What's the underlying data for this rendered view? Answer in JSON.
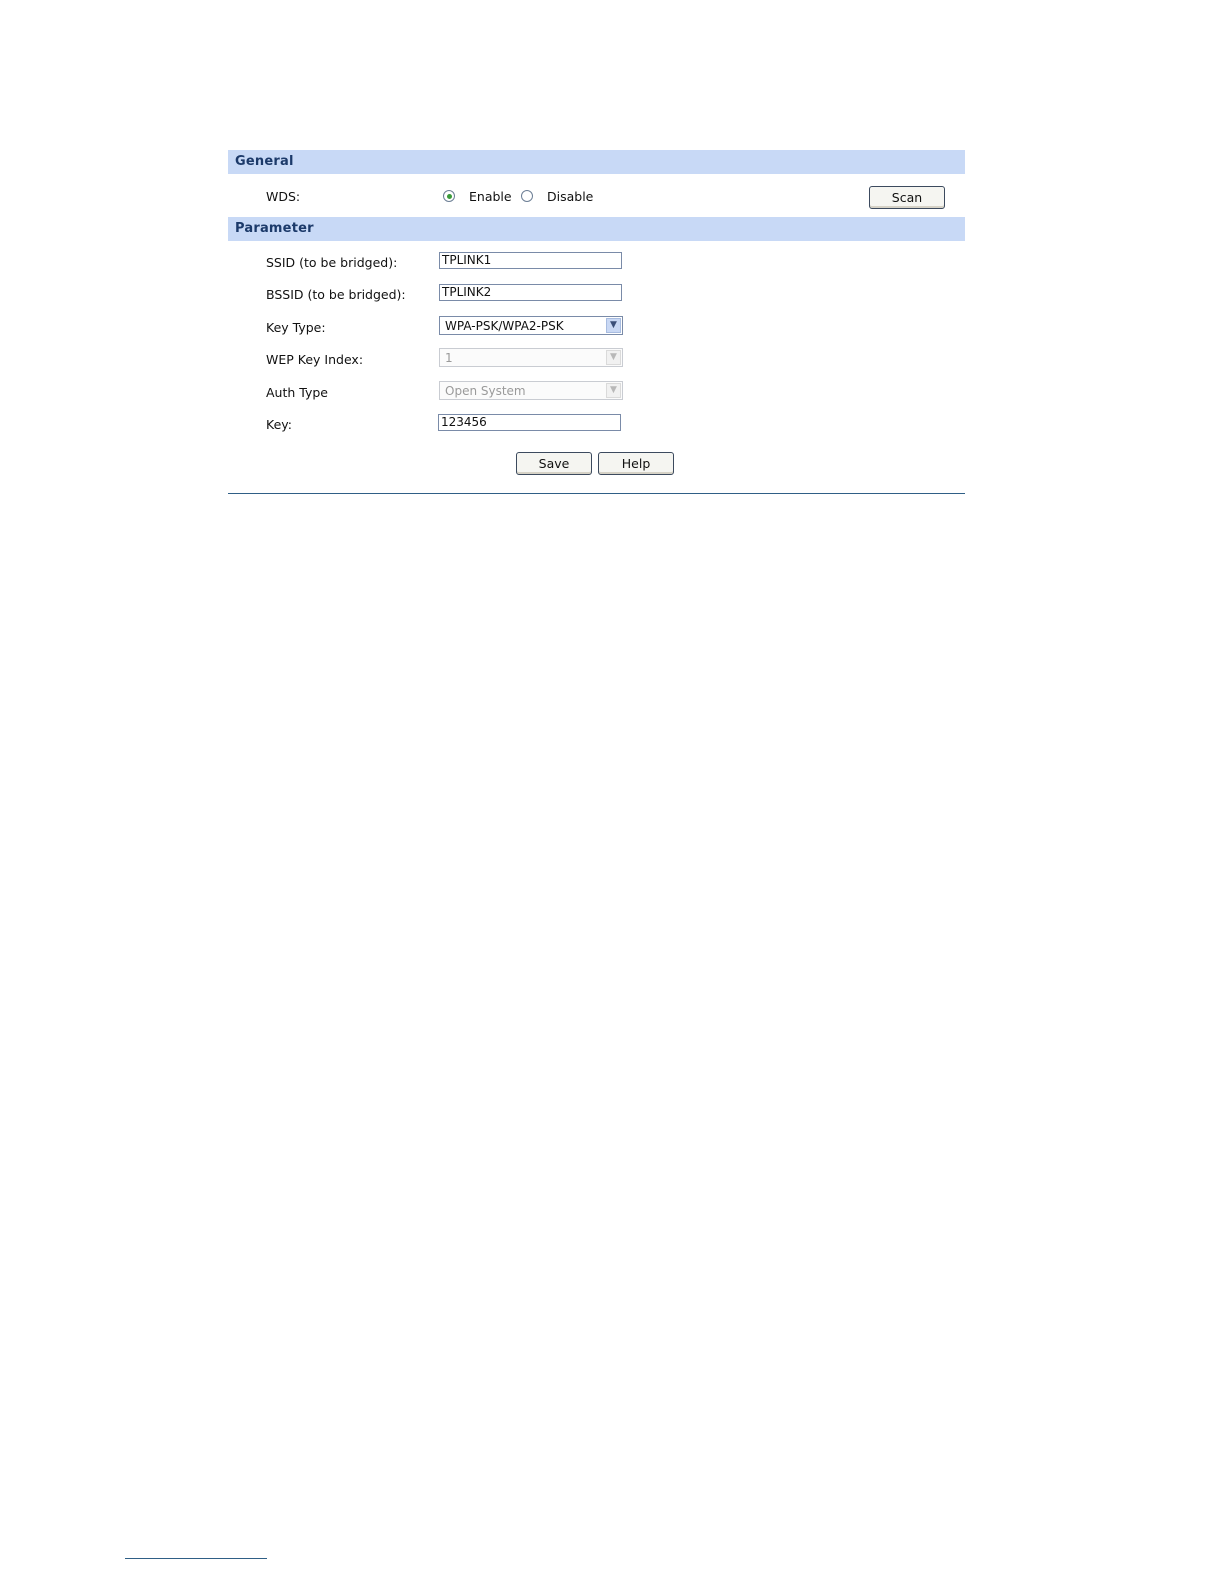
{
  "sections": {
    "general": {
      "title": "General"
    },
    "parameter": {
      "title": "Parameter"
    }
  },
  "wds": {
    "label": "WDS:",
    "options": [
      "Enable",
      "Disable"
    ],
    "selected": "Enable",
    "scan_label": "Scan"
  },
  "fields": {
    "ssid": {
      "label": "SSID (to be bridged):",
      "value": "TPLINK1"
    },
    "bssid": {
      "label": "BSSID (to be bridged):",
      "value": "TPLINK2"
    },
    "key_type": {
      "label": "Key Type:",
      "value": "WPA-PSK/WPA2-PSK",
      "enabled": true
    },
    "wep_key_index": {
      "label": "WEP Key Index:",
      "value": "1",
      "enabled": false
    },
    "auth_type": {
      "label": "Auth Type",
      "value": "Open System",
      "enabled": false
    },
    "key": {
      "label": "Key:",
      "value": "123456"
    }
  },
  "actions": {
    "save_label": "Save",
    "help_label": "Help"
  },
  "colors": {
    "section_header_bg": "#c8d9f6",
    "section_header_text": "#1c3a6a",
    "rule": "#2f5f86",
    "radio_selected": "#3a9a3a"
  },
  "icons": {
    "dropdown": "chevron-down-icon",
    "radio": "radio-icon"
  }
}
